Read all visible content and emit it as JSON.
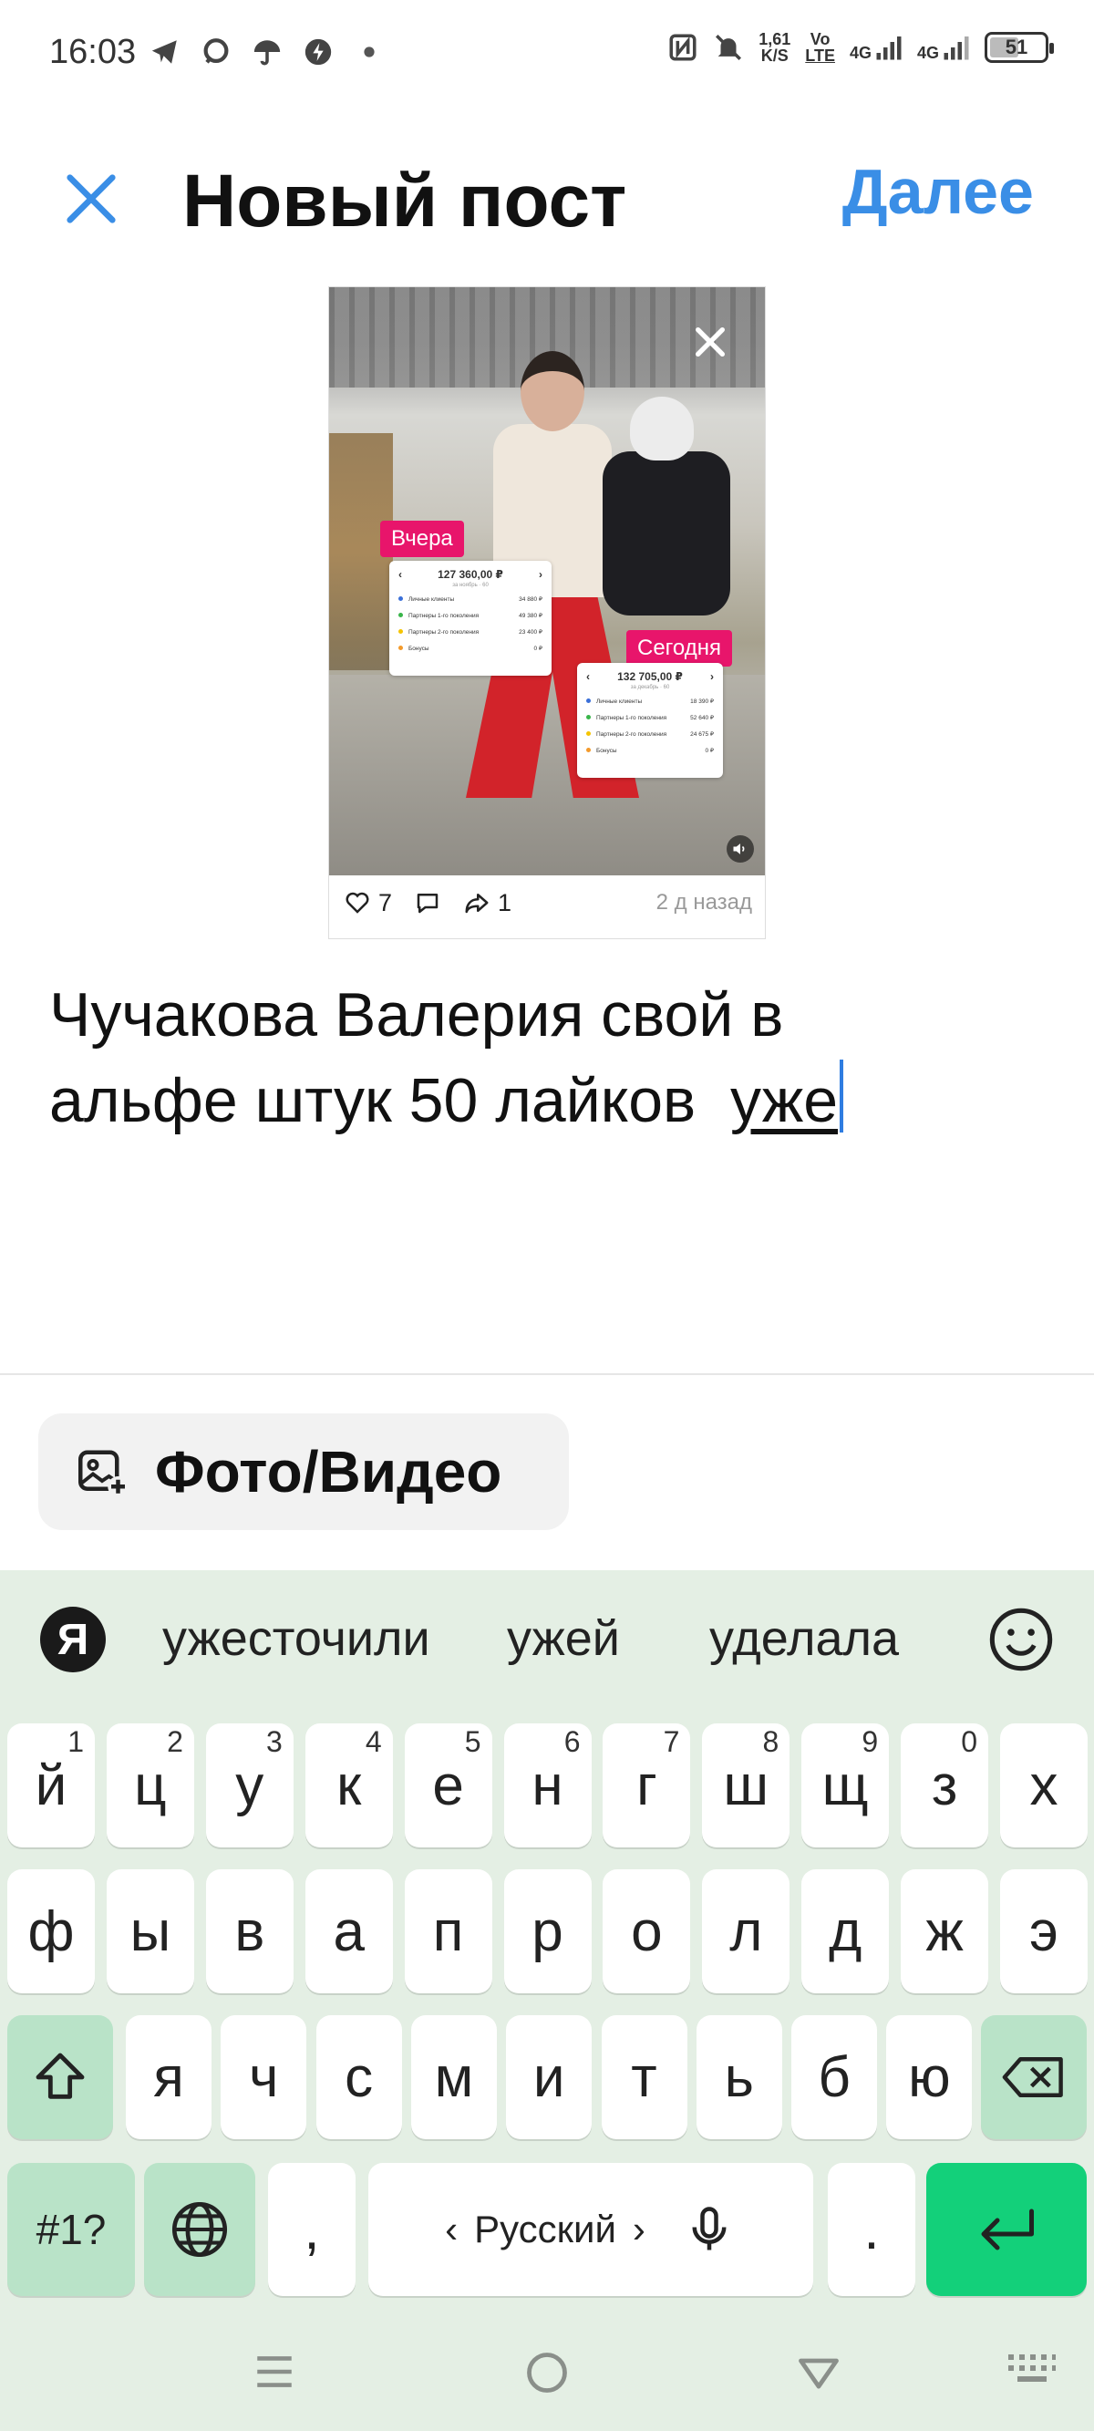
{
  "status_bar": {
    "time": "16:03",
    "net_speed_value": "1,61",
    "net_speed_unit": "K/S",
    "volte_top": "Vo",
    "volte_bottom": "LTE",
    "signal1": "4G",
    "signal2": "4G",
    "battery": "51",
    "left_icons": [
      "telegram-icon",
      "chat-icon",
      "umbrella-icon",
      "alert-icon",
      "dot-icon"
    ],
    "right_icons": [
      "nfc-icon",
      "mute-icon"
    ]
  },
  "header": {
    "title": "Новый пост",
    "next_label": "Далее"
  },
  "preview": {
    "tag_yesterday": "Вчера",
    "tag_today": "Сегодня",
    "card1": {
      "amount": "127 360,00 ₽",
      "sub": "за ноябрь · 60",
      "rows": [
        {
          "label": "Личные клиенты",
          "value": "34 880 ₽",
          "color": "#3a6fd8"
        },
        {
          "label": "Партнеры 1-го поколения",
          "value": "49 380 ₽",
          "color": "#39b54a"
        },
        {
          "label": "Партнеры 2-го поколения",
          "value": "23 400 ₽",
          "color": "#f5c400"
        },
        {
          "label": "Бонусы",
          "value": "0 ₽",
          "color": "#f39a2b"
        }
      ]
    },
    "card2": {
      "amount": "132 705,00 ₽",
      "sub": "за декабрь · 60",
      "rows": [
        {
          "label": "Личные клиенты",
          "value": "18 390 ₽",
          "color": "#3a6fd8"
        },
        {
          "label": "Партнеры 1-го поколения",
          "value": "52 640 ₽",
          "color": "#39b54a"
        },
        {
          "label": "Партнеры 2-го поколения",
          "value": "24 675 ₽",
          "color": "#f5c400"
        },
        {
          "label": "Бонусы",
          "value": "0 ₽",
          "color": "#f39a2b"
        }
      ]
    },
    "likes": "7",
    "reposts": "1",
    "time_ago": "2 д назад"
  },
  "post_text": {
    "line1": "Чучакова Валерия свой в",
    "line2_before": "альфе штук 50 лайков  ",
    "line2_underlined": "уже"
  },
  "media_button": {
    "label": "Фото/Видео"
  },
  "keyboard": {
    "logo": "Я",
    "suggestions": [
      "ужесточили",
      "ужей",
      "уделала"
    ],
    "row1": [
      {
        "k": "й",
        "n": "1"
      },
      {
        "k": "ц",
        "n": "2"
      },
      {
        "k": "у",
        "n": "3"
      },
      {
        "k": "к",
        "n": "4"
      },
      {
        "k": "е",
        "n": "5"
      },
      {
        "k": "н",
        "n": "6"
      },
      {
        "k": "г",
        "n": "7"
      },
      {
        "k": "ш",
        "n": "8"
      },
      {
        "k": "щ",
        "n": "9"
      },
      {
        "k": "з",
        "n": "0"
      },
      {
        "k": "х",
        "n": ""
      }
    ],
    "row2": [
      "ф",
      "ы",
      "в",
      "а",
      "п",
      "р",
      "о",
      "л",
      "д",
      "ж",
      "э"
    ],
    "row3": [
      "я",
      "ч",
      "с",
      "м",
      "и",
      "т",
      "ь",
      "б",
      "ю"
    ],
    "sym_label": "#1?",
    "comma": ",",
    "space_label": "Русский",
    "period": "."
  }
}
